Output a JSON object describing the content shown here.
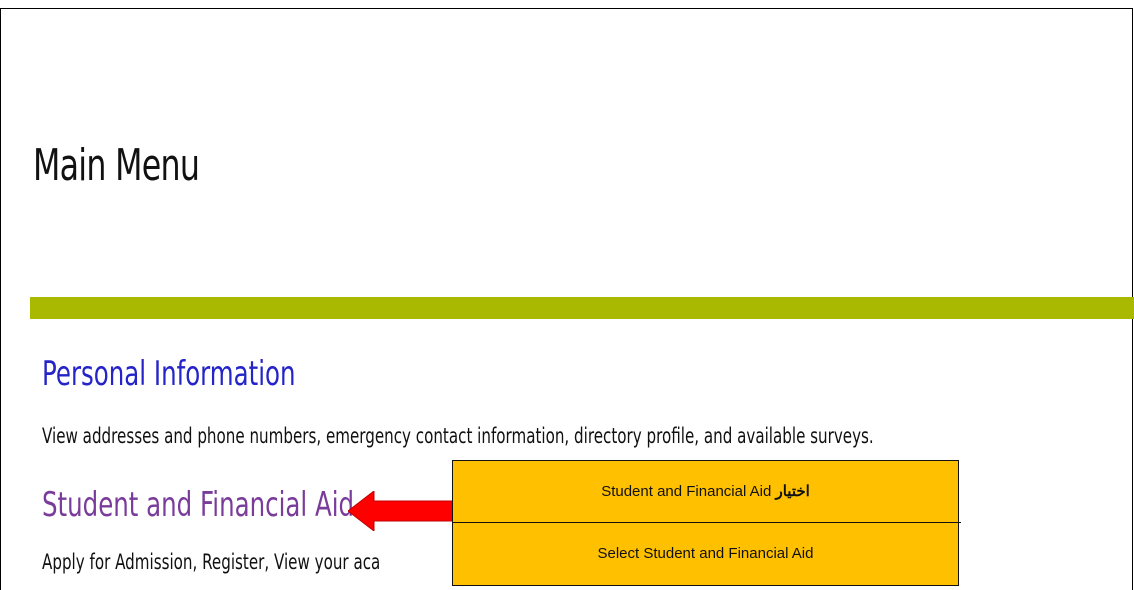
{
  "page": {
    "title": "Main Menu"
  },
  "menu": [
    {
      "link": "Personal Information",
      "description": "View addresses and phone numbers, emergency contact information, directory profile, and available surveys."
    },
    {
      "link": "Student and Financial Aid",
      "description": "Apply for Admission, Register, View your aca"
    }
  ],
  "callout": {
    "arabic_word": "اختيار",
    "arabic_line_rest": "Student and Financial Aid",
    "english_line": "Select Student and Financial Aid"
  },
  "colors": {
    "accent_bar": "#a9b800",
    "link_unvisited": "#2424c8",
    "link_visited": "#7a3c9a",
    "callout_bg": "#ffc000",
    "arrow": "#ff0000"
  },
  "icons": {
    "pointer_arrow": "left-arrow-icon"
  }
}
